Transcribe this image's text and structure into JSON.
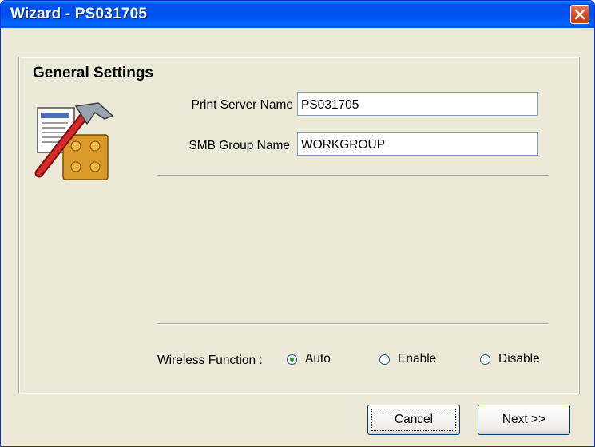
{
  "window": {
    "title": "Wizard - PS031705",
    "close_icon": "close-icon"
  },
  "section": {
    "title": "General Settings",
    "icon": "wizard-hammer-icon"
  },
  "fields": {
    "print_server_name": {
      "label": "Print Server Name",
      "value": "PS031705"
    },
    "smb_group_name": {
      "label": "SMB Group Name",
      "value": "WORKGROUP"
    }
  },
  "wireless": {
    "label": "Wireless Function :",
    "options": [
      {
        "label": "Auto",
        "selected": true
      },
      {
        "label": "Enable",
        "selected": false
      },
      {
        "label": "Disable",
        "selected": false
      }
    ]
  },
  "buttons": {
    "cancel": "Cancel",
    "next": "Next >>"
  },
  "colors": {
    "titlebar": "#0054e3",
    "dialog_bg": "#ece9d8",
    "close_red": "#d6451c"
  }
}
